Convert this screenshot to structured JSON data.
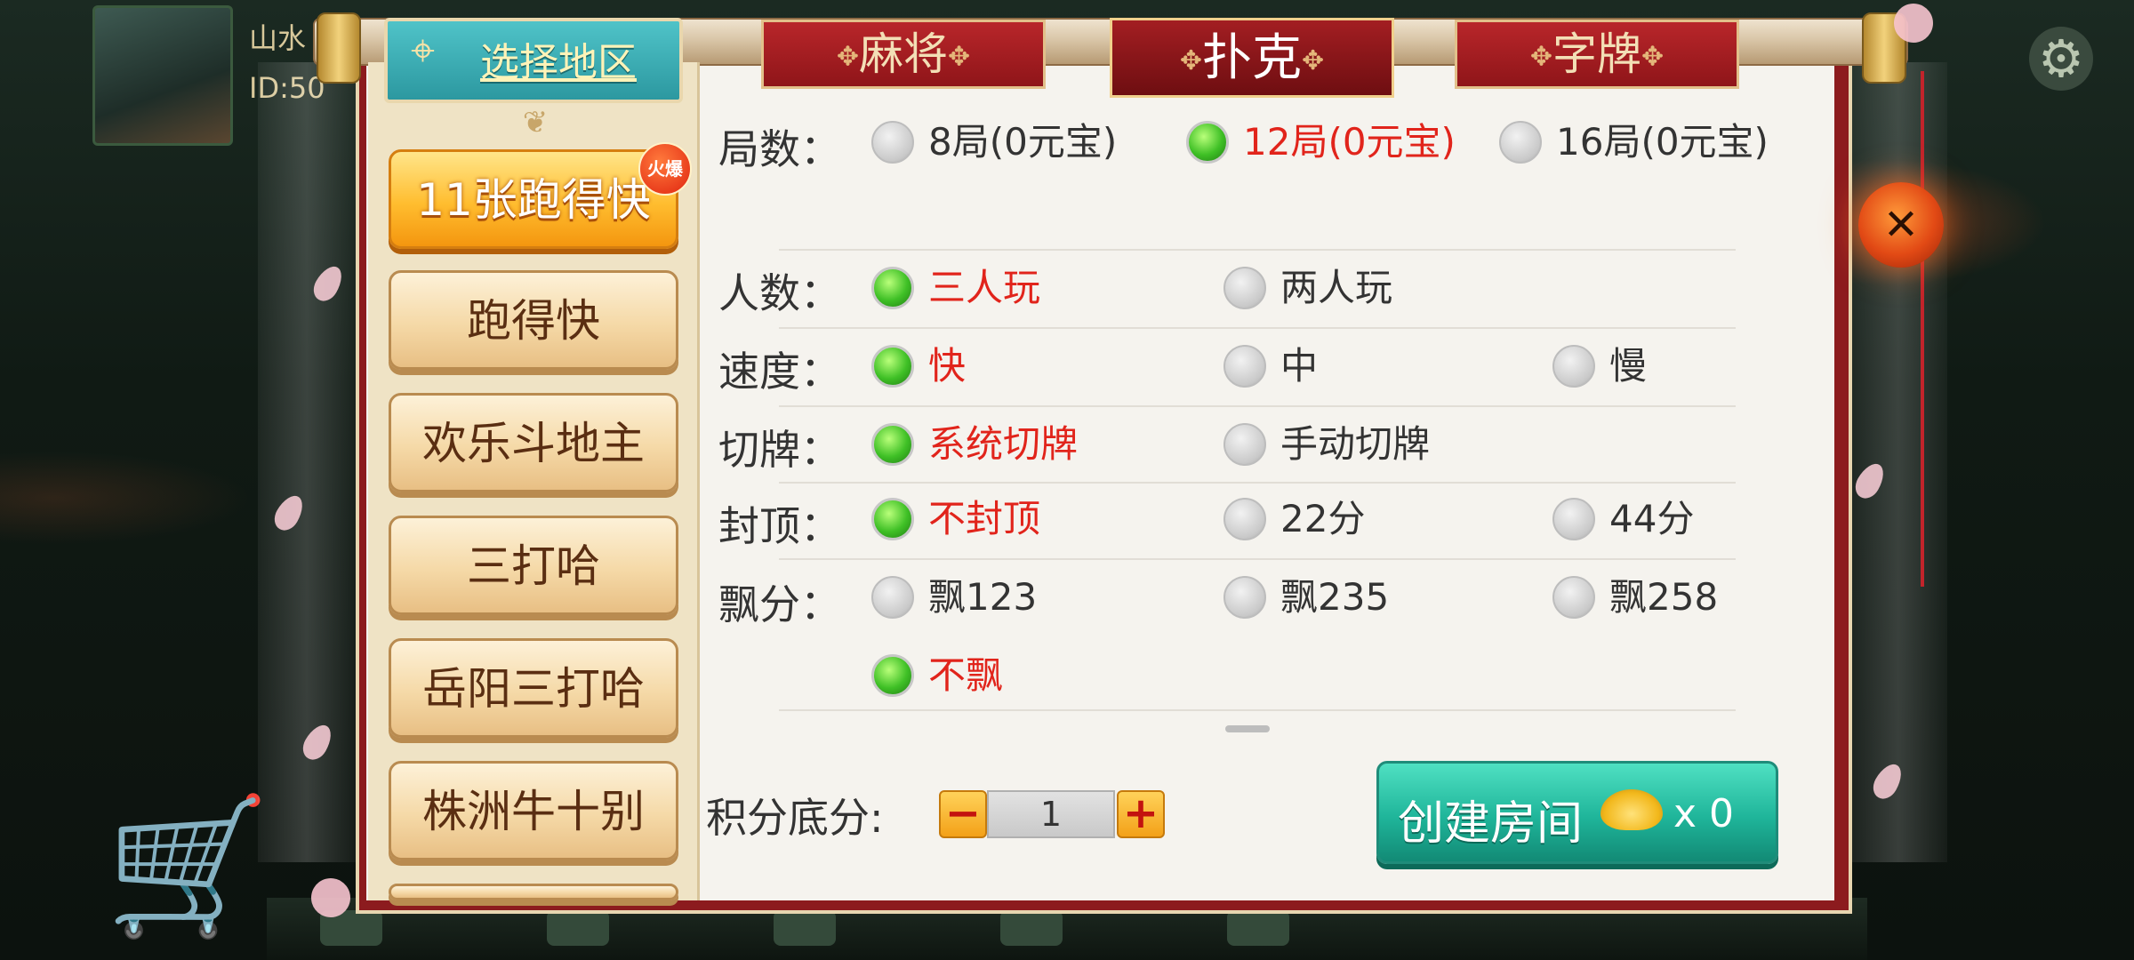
{
  "header": {
    "username": "山水",
    "user_id": "ID:50"
  },
  "region": {
    "label": "选择地区"
  },
  "tabs": [
    {
      "label": "麻将",
      "active": false
    },
    {
      "label": "扑克",
      "active": true
    },
    {
      "label": "字牌",
      "active": false
    }
  ],
  "sidebar": {
    "items": [
      {
        "label": "11张跑得快",
        "active": true
      },
      {
        "label": "跑得快",
        "active": false
      },
      {
        "label": "欢乐斗地主",
        "active": false
      },
      {
        "label": "三打哈",
        "active": false
      },
      {
        "label": "岳阳三打哈",
        "active": false
      },
      {
        "label": "株洲牛十别",
        "active": false
      }
    ],
    "hot_badge": "火爆"
  },
  "rows": {
    "rounds": {
      "label": "局数：",
      "options": [
        "8局(0元宝)",
        "12局(0元宝)",
        "16局(0元宝)"
      ],
      "selected": 1
    },
    "players": {
      "label": "人数：",
      "options": [
        "三人玩",
        "两人玩"
      ],
      "selected": 0
    },
    "speed": {
      "label": "速度：",
      "options": [
        "快",
        "中",
        "慢"
      ],
      "selected": 0
    },
    "shuffle": {
      "label": "切牌：",
      "options": [
        "系统切牌",
        "手动切牌"
      ],
      "selected": 0
    },
    "cap": {
      "label": "封顶：",
      "options": [
        "不封顶",
        "22分",
        "44分"
      ],
      "selected": 0
    },
    "piao": {
      "label": "飘分：",
      "options": [
        "飘123",
        "飘235",
        "飘258",
        "不飘"
      ],
      "selected": 3
    }
  },
  "score": {
    "label": "积分底分:",
    "value": "1",
    "minus": "−",
    "plus": "+"
  },
  "create": {
    "label": "创建房间",
    "count": "x 0"
  },
  "colors": {
    "accent_red": "#e1241b",
    "selected_green": "#3fc026",
    "panel_red": "#8c1b1e"
  }
}
